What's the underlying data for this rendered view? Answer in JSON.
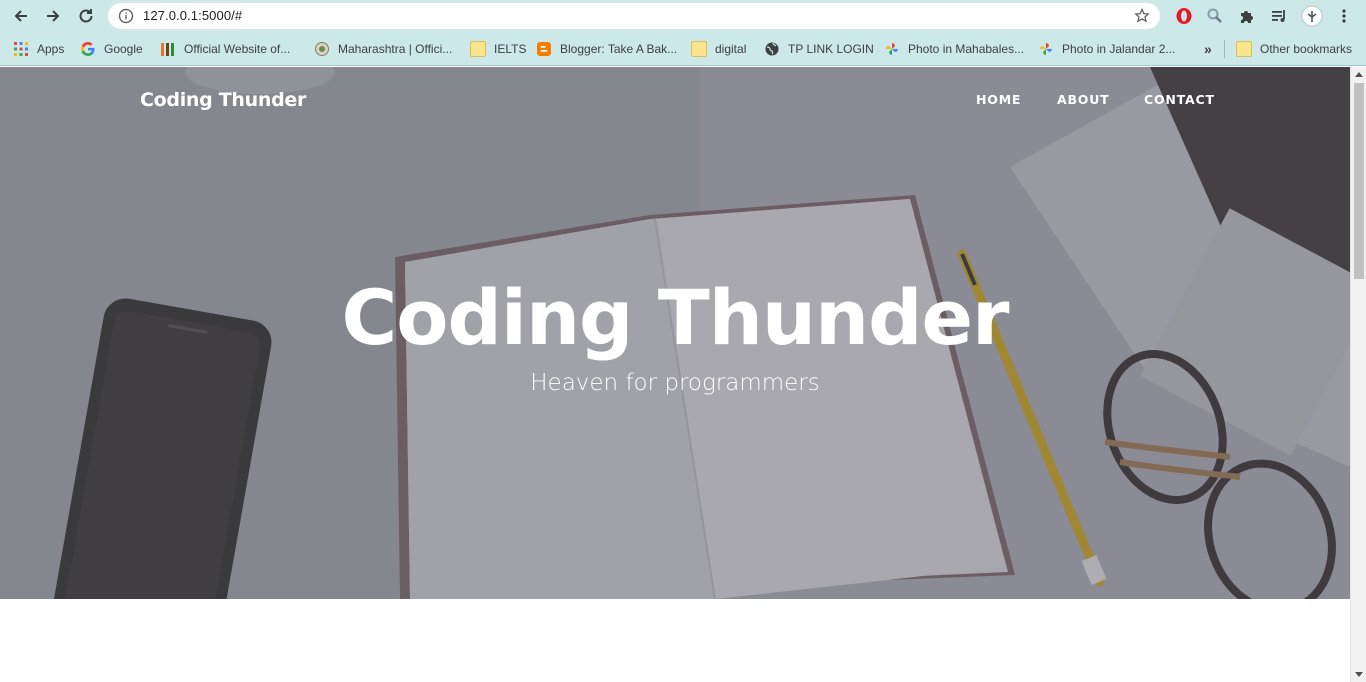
{
  "browser": {
    "url": "127.0.0.1:5000/#",
    "bookmarks": [
      {
        "label": "Apps",
        "icon": "apps-grid-icon"
      },
      {
        "label": "Google",
        "icon": "google-icon"
      },
      {
        "label": "Official Website of...",
        "icon": "site-favicon-icon"
      },
      {
        "label": "Maharashtra | Offici...",
        "icon": "emblem-icon"
      },
      {
        "label": "IELTS",
        "icon": "folder-icon"
      },
      {
        "label": "Blogger: Take A Bak...",
        "icon": "blogger-icon"
      },
      {
        "label": "digital",
        "icon": "folder-icon"
      },
      {
        "label": "TP LINK LOGIN",
        "icon": "globe-icon"
      },
      {
        "label": "Photo in Mahabales...",
        "icon": "photos-icon"
      },
      {
        "label": "Photo in Jalandar 2...",
        "icon": "photos-icon"
      }
    ],
    "overflow_label": "»",
    "other_bookmarks": "Other bookmarks"
  },
  "page": {
    "brand": "Coding Thunder",
    "nav": [
      "HOME",
      "ABOUT",
      "CONTACT"
    ],
    "hero_title": "Coding Thunder",
    "hero_subtitle": "Heaven for programmers"
  },
  "colors": {
    "chrome": "#cde8e8",
    "hero_overlay": "#8d8f97"
  }
}
